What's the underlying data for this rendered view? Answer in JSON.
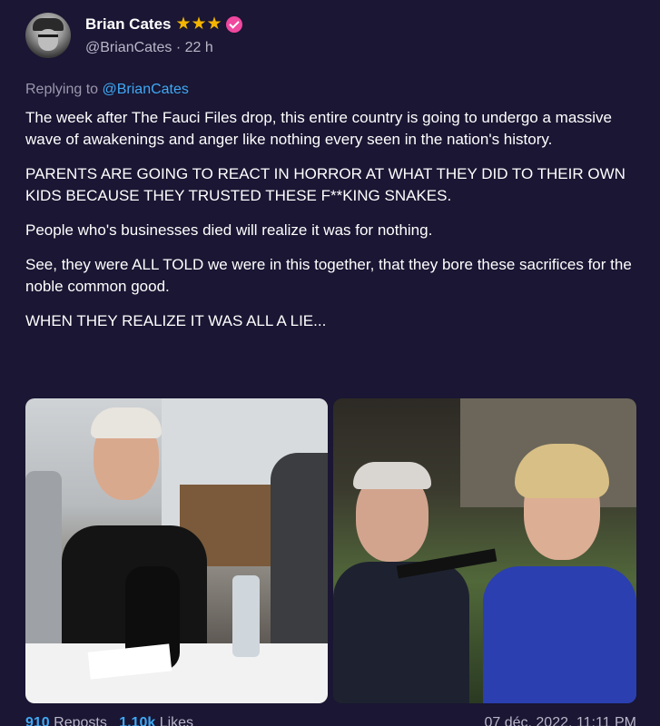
{
  "tweet": {
    "author_name": "Brian Cates",
    "rank_stars": "★★★",
    "handle": "@BrianCates",
    "time_ago": "22 h",
    "replying_prefix": "Replying to",
    "replying_to": "@BrianCates",
    "paragraphs": [
      "The week after The Fauci Files drop, this entire country is going to undergo a massive wave of awakenings and anger like nothing every seen in the nation's history.",
      "PARENTS ARE GOING TO REACT IN HORROR AT WHAT THEY DID TO THEIR OWN KIDS BECAUSE THEY TRUSTED THESE F**KING SNAKES.",
      "People who's businesses died will realize it was for nothing.",
      "See, they were ALL TOLD we were in this together, that they bore these sacrifices for the noble common good.",
      "WHEN THEY REALIZE IT WAS ALL A LIE..."
    ],
    "footer": {
      "reposts_count": "910",
      "reposts_label": "Reposts",
      "likes_count": "1,10k",
      "likes_label": "Likes",
      "date": "07 déc. 2022, 11:11 PM"
    }
  },
  "colors": {
    "background": "#1a1633",
    "accent": "#3fa9f5",
    "verified": "#f0479f",
    "stars": "#f4b400"
  }
}
